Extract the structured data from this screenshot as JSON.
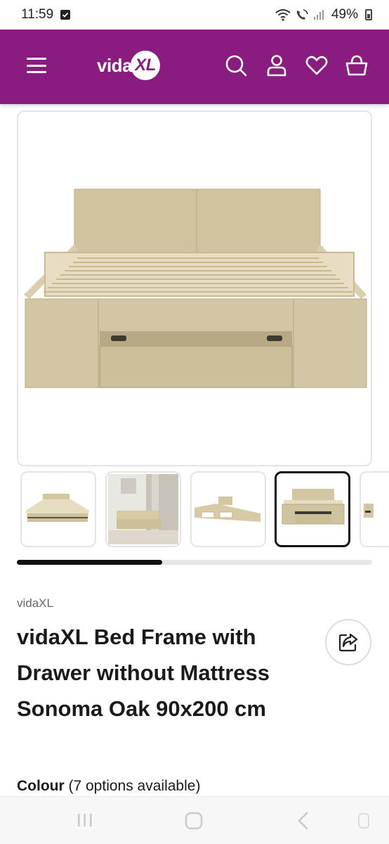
{
  "status_bar": {
    "time": "11:59",
    "battery": "49%"
  },
  "header": {
    "logo_text": "vida",
    "logo_badge": "XL",
    "brand_color": "#8a1c80",
    "icons": [
      "menu-icon",
      "search-icon",
      "account-icon",
      "wishlist-heart-icon",
      "cart-basket-icon"
    ]
  },
  "gallery": {
    "thumbnail_count_visible": 5,
    "active_thumbnail_index": 3,
    "scroll_progress": 0.41
  },
  "product": {
    "brand": "vidaXL",
    "title_lines": [
      "vidaXL Bed Frame with",
      "Drawer without Mattress",
      "Sonoma Oak 90x200 cm"
    ],
    "colour_label": "Colour",
    "colour_options_text": "(7 options available)"
  },
  "nav_bar": {
    "icons": [
      "recent-apps-icon",
      "home-icon",
      "back-icon",
      "assistant-icon"
    ]
  }
}
